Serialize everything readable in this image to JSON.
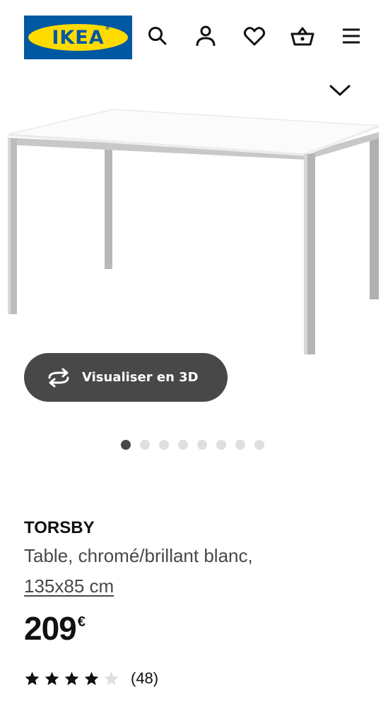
{
  "header": {
    "logo_text": "IKEA",
    "logo_reg": "®",
    "icons": [
      "search-icon",
      "account-icon",
      "favorites-heart-icon",
      "shopping-basket-icon",
      "menu-hamburger-icon"
    ]
  },
  "gallery": {
    "button_3d_label": "Visualiser en 3D",
    "dot_count": 8,
    "active_dot": 1
  },
  "product": {
    "name": "TORSBY",
    "description": "Table, chromé/brillant blanc,",
    "size": "135x85 cm",
    "price": "209",
    "currency": "€",
    "rating": 4,
    "rating_max": 5,
    "review_count": "(48)"
  },
  "colors": {
    "ikea_blue": "#0058a3",
    "ikea_yellow": "#ffdb00",
    "button_dark": "#484848",
    "text_primary": "#111111",
    "text_secondary": "#484848"
  }
}
